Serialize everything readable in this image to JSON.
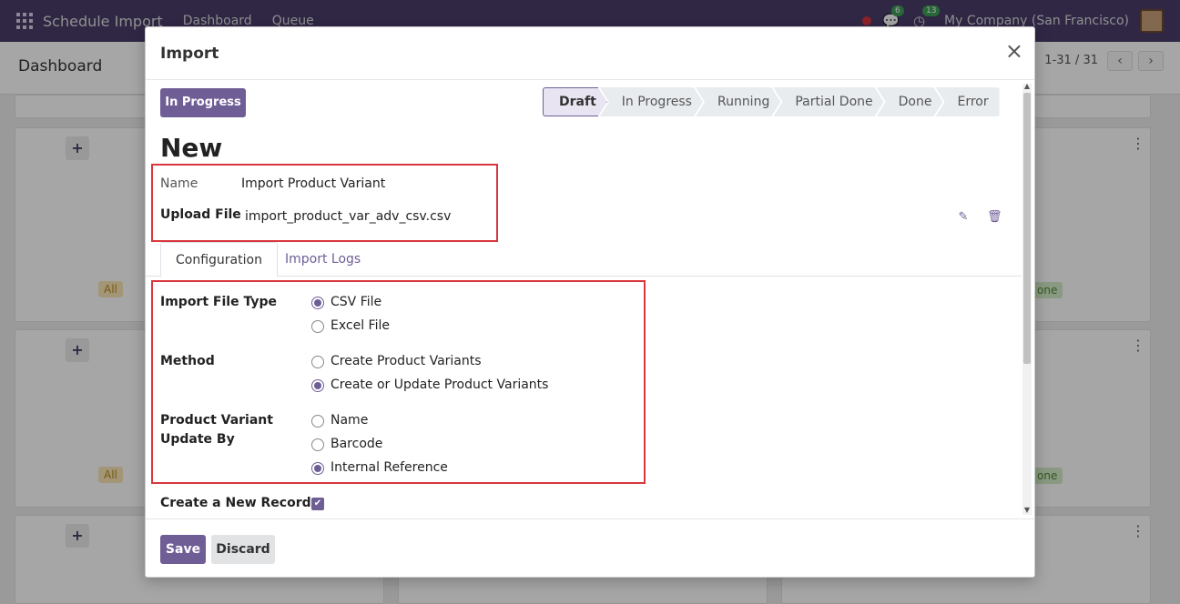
{
  "navbar": {
    "app_name": "Schedule Import",
    "menu": [
      "Dashboard",
      "Queue"
    ],
    "messages_count": "6",
    "activities_count": "13",
    "company": "My Company (San Francisco)"
  },
  "control_panel": {
    "title": "Dashboard",
    "pager": "1-31 / 31",
    "prev": "‹",
    "next": "›"
  },
  "background": {
    "tag_all": "All",
    "tag_done": "one"
  },
  "modal": {
    "title": "Import",
    "close": "×",
    "status_button": "In Progress",
    "stages": [
      "Draft",
      "In Progress",
      "Running",
      "Partial Done",
      "Done",
      "Error"
    ],
    "active_stage": "Draft",
    "record_title": "New",
    "name_label": "Name",
    "name_value": "Import Product Variant",
    "upload_label": "Upload File",
    "upload_value": "import_product_var_adv_csv.csv",
    "tabs": [
      "Configuration",
      "Import Logs"
    ],
    "config": {
      "file_type_label": "Import File Type",
      "file_type_options": [
        "CSV File",
        "Excel File"
      ],
      "file_type_selected": "CSV File",
      "method_label": "Method",
      "method_options": [
        "Create Product Variants",
        "Create or Update Product Variants"
      ],
      "method_selected": "Create or Update Product Variants",
      "update_by_label_1": "Product Variant",
      "update_by_label_2": "Update By",
      "update_by_options": [
        "Name",
        "Barcode",
        "Internal Reference"
      ],
      "update_by_selected": "Internal Reference",
      "create_record_label": "Create a New Record",
      "create_record_checked": true
    },
    "footer": {
      "save": "Save",
      "discard": "Discard"
    }
  },
  "colors": {
    "brand": "#4a3d6b",
    "primary": "#6f5e96",
    "highlight_border": "#d9363e"
  }
}
